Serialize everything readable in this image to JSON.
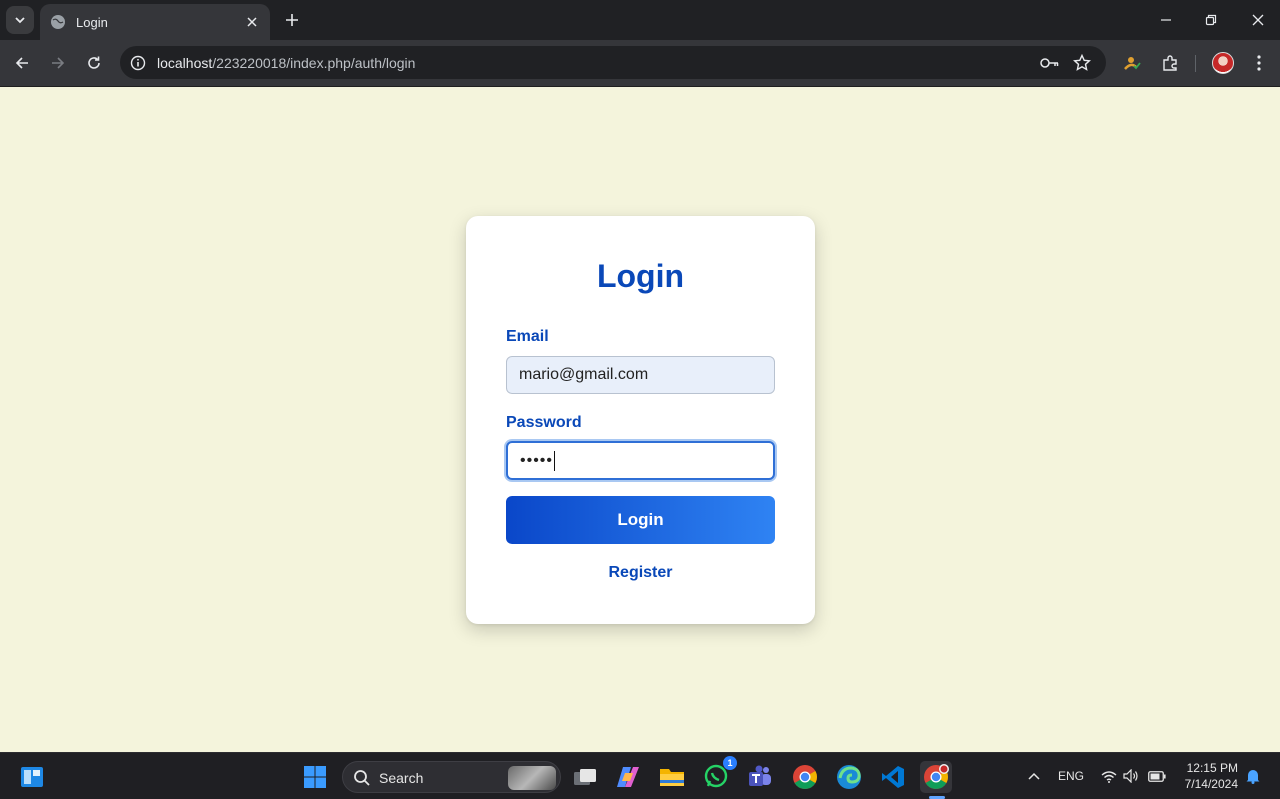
{
  "browser": {
    "tab_title": "Login",
    "url_host": "localhost",
    "url_path": "/223220018/index.php/auth/login"
  },
  "login": {
    "heading": "Login",
    "email_label": "Email",
    "email_value": "mario@gmail.com",
    "password_label": "Password",
    "password_mask": "•••••",
    "login_button": "Login",
    "register_link": "Register"
  },
  "taskbar": {
    "search_label": "Search",
    "whatsapp_badge": "1",
    "language": "ENG",
    "time": "12:15 PM",
    "date": "7/14/2024"
  },
  "colors": {
    "page_background": "#f4f4dc",
    "accent": "#0a48b8",
    "button_gradient_start": "#0a47c9",
    "button_gradient_end": "#2f83f3"
  }
}
